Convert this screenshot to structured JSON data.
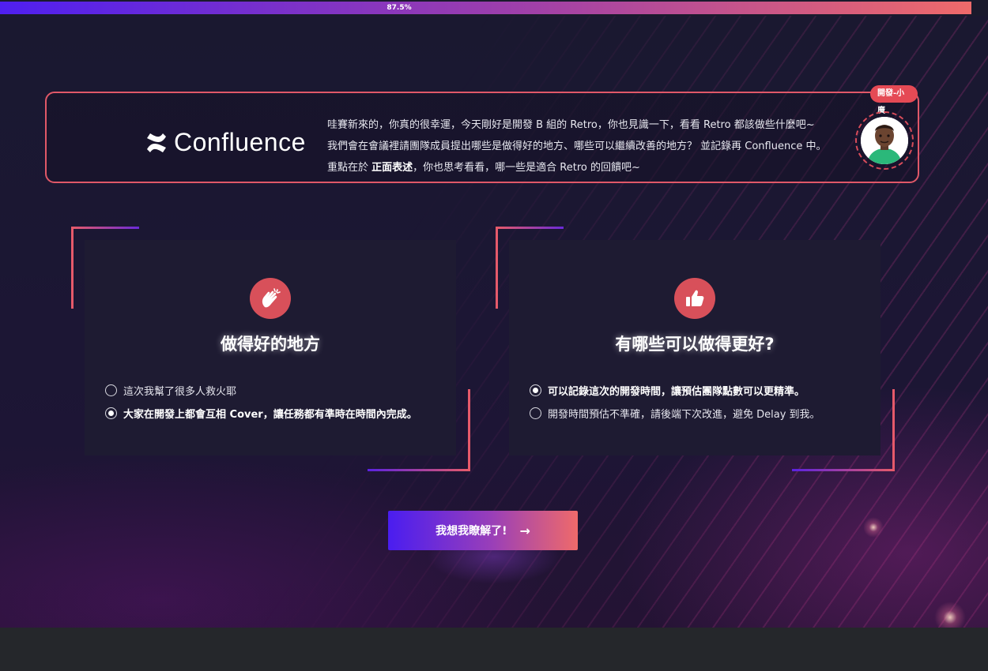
{
  "progress": {
    "label": "87.5%",
    "value": 0.875
  },
  "intro": {
    "brand": "Confluence",
    "badge": "開發-小廣",
    "line1": "哇賽新來的，你真的很幸運，今天剛好是開發 B 組的 Retro，你也見識一下，看看 Retro 都該做些什麼吧~",
    "line2": "我們會在會議裡請團隊成員提出哪些是做得好的地方、哪些可以繼續改善的地方？ 並記錄再 Confluence 中。",
    "line3_prefix": "重點在於 ",
    "line3_emphasis": "正面表述",
    "line3_suffix": "，你也思考看看，哪一些是適合 Retro 的回饋吧~"
  },
  "cards": [
    {
      "icon": "clapping-hands-icon",
      "title": "做得好的地方",
      "options": [
        {
          "label": "這次我幫了很多人救火耶",
          "selected": false
        },
        {
          "label": "大家在開發上都會互相 Cover，讓任務都有準時在時間內完成。",
          "selected": true
        }
      ]
    },
    {
      "icon": "thumbs-up-icon",
      "title": "有哪些可以做得更好?",
      "options": [
        {
          "label": "可以記錄這次的開發時間，讓預估團隊點數可以更精準。",
          "selected": true
        },
        {
          "label": "開發時間預估不準確，請後端下次改進，避免 Delay 到我。",
          "selected": false
        }
      ]
    }
  ],
  "cta": {
    "label": "我想我瞭解了!",
    "arrow": "→"
  },
  "colors": {
    "accent": "#e05868",
    "gradient_start": "#4a1df0",
    "gradient_end": "#ef6a6a",
    "card_bg": "#1e1b32"
  }
}
